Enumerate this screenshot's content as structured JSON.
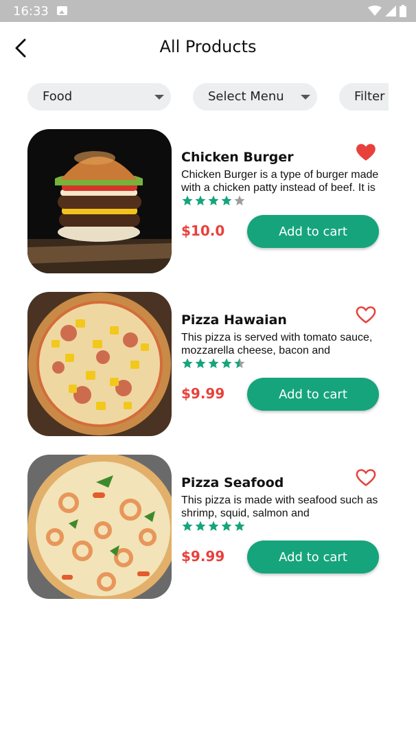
{
  "status_bar": {
    "time": "16:33"
  },
  "header": {
    "title": "All Products"
  },
  "filters": [
    {
      "label": "Food"
    },
    {
      "label": "Select Menu"
    },
    {
      "label": "Filter by"
    }
  ],
  "products": [
    {
      "name": "Chicken Burger",
      "description": "Chicken Burger is a type of burger made with a chicken patty instead of beef. It is",
      "price": "$10.0",
      "rating": 4,
      "favorite": true,
      "button_label": "Add to cart"
    },
    {
      "name": "Pizza Hawaian",
      "description": "This pizza is served with tomato sauce, mozzarella cheese, bacon and",
      "price": "$9.99",
      "rating": 4.5,
      "favorite": false,
      "button_label": "Add to cart"
    },
    {
      "name": "Pizza Seafood",
      "description": "This pizza is made with seafood such as shrimp, squid, salmon and",
      "price": "$9.99",
      "rating": 5,
      "favorite": false,
      "button_label": "Add to cart"
    }
  ],
  "colors": {
    "accent": "#16a47c",
    "price": "#e8413c",
    "favorite": "#e8413c",
    "star_on": "#16a47c",
    "star_off": "#9e9e9e",
    "chip_bg": "#eceef0"
  },
  "icons": {
    "back": "back-arrow-icon",
    "favorite": "heart-icon",
    "rating": "star-icon",
    "dropdown": "caret-down-icon"
  }
}
